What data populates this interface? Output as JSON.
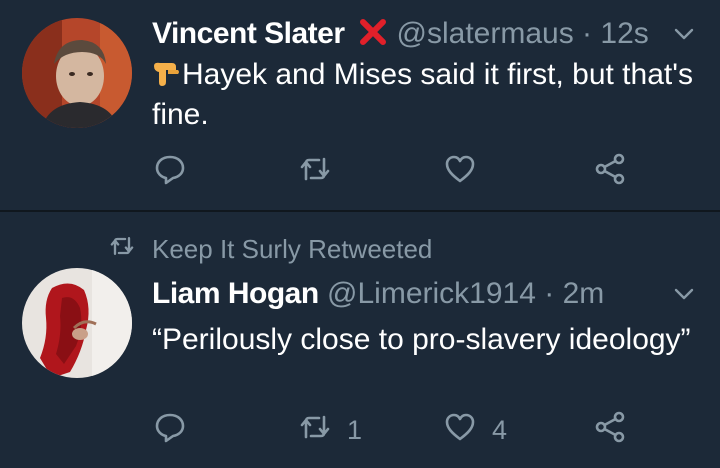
{
  "tweets": [
    {
      "name": "Vincent Slater",
      "handle": "@slatermaus",
      "separator": "·",
      "time": "12s",
      "text": "Hayek and Mises said it first, but that's fine.",
      "reply_count": "",
      "retweet_count": "",
      "like_count": "",
      "badge_icon": "red-x-icon",
      "emoji_icon": "backhand-index-pointing-down-emoji"
    },
    {
      "retweeted_by": "Keep It Surly Retweeted",
      "name": "Liam Hogan",
      "handle": "@Limerick1914",
      "separator": "·",
      "time": "2m",
      "text": "“Perilously close to pro-slavery ideology”",
      "reply_count": "",
      "retweet_count": "1",
      "like_count": "4"
    }
  ],
  "colors": {
    "background": "#1c2938",
    "divider": "#10171e",
    "text_primary": "#ffffff",
    "text_secondary": "#8899a6",
    "badge_red": "#e0202a"
  }
}
